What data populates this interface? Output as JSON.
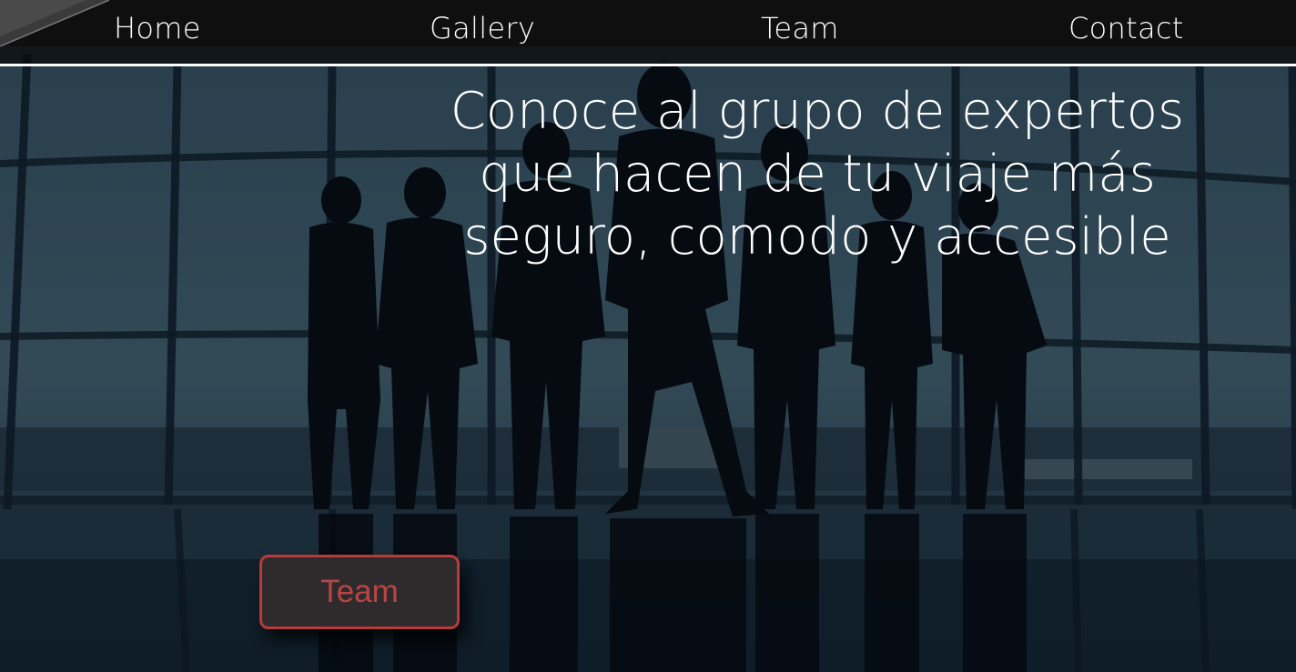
{
  "nav": {
    "items": [
      {
        "label": "Home"
      },
      {
        "label": "Gallery"
      },
      {
        "label": "Team"
      },
      {
        "label": "Contact"
      }
    ]
  },
  "hero": {
    "title": "Conoce al grupo de expertos que hacen de tu viaje más seguro, comodo y accesible",
    "button_label": "Team"
  },
  "colors": {
    "nav_background": "#0f0f10",
    "button_border": "#b83a3a",
    "button_text": "#b84545",
    "button_background": "#2f2b2c"
  }
}
